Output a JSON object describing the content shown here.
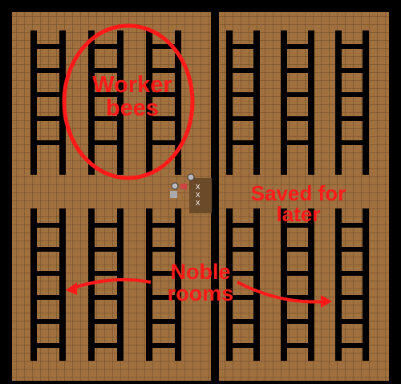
{
  "screen": {
    "title": "",
    "annotations": {
      "worker_bees": "Worker\nbees",
      "saved_for_later": "Saved for\nlater",
      "noble_rooms": "Noble\nrooms"
    }
  },
  "palette": {
    "background": "#000000",
    "floor": "#a0703f",
    "grid_line": "#6e4a25",
    "wall": "#000000",
    "workshop_floor": "#6b4a2a",
    "annotation": "#ff1a1a"
  },
  "map": {
    "tile_grid": true,
    "items": [
      "gear-icon",
      "gear-icon",
      "gray-block-icon",
      "red-item-icon",
      "x-marker-icon",
      "x-marker-icon",
      "x-marker-icon"
    ]
  }
}
